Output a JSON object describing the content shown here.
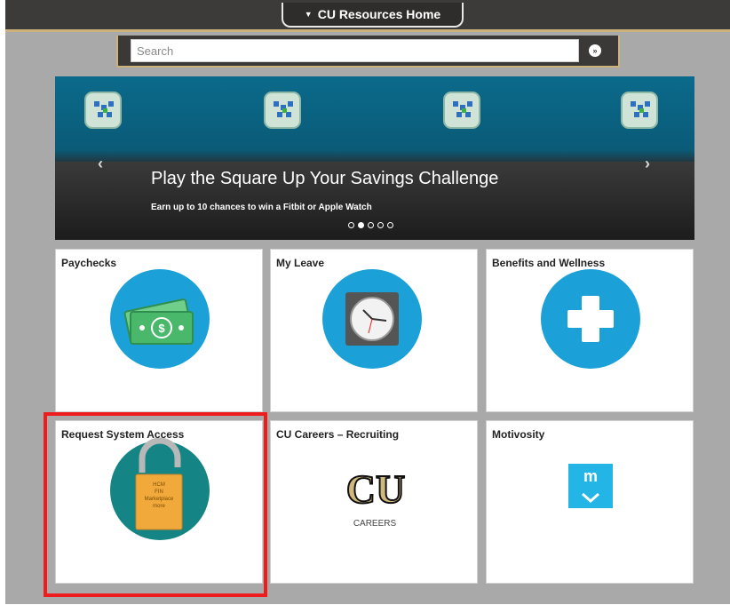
{
  "header": {
    "home_label": "CU Resources Home"
  },
  "search": {
    "placeholder": "Search"
  },
  "banner": {
    "title": "Play the Square Up Your Savings Challenge",
    "subtitle": "Earn up to 10 chances to win a Fitbit or Apple Watch",
    "active_slide": 2,
    "slide_count": 5,
    "icon": "savings-game-board-icon"
  },
  "tiles": [
    {
      "label": "Paychecks",
      "icon": "money-bill-icon",
      "color": "#1ba1d8"
    },
    {
      "label": "My Leave",
      "icon": "clock-icon",
      "color": "#1ba1d8"
    },
    {
      "label": "Benefits and Wellness",
      "icon": "medical-cross-icon",
      "color": "#1ba1d8"
    },
    {
      "label": "Request System Access",
      "icon": "padlock-open-icon",
      "color": "#148484",
      "lock_text": [
        "HCM",
        "FIN",
        "Marketplace",
        "more"
      ]
    },
    {
      "label": "CU Careers – Recruiting",
      "icon": "cu-logo-icon",
      "logo_caption": "CAREERS"
    },
    {
      "label": "Motivosity",
      "icon": "motivosity-logo-icon",
      "color": "#22b5e6",
      "logo_text": "m"
    }
  ],
  "colors": {
    "accent_gold": "#cbb27b",
    "highlight": "#ee1c1c",
    "banner_blue": "#0b6a8b"
  }
}
